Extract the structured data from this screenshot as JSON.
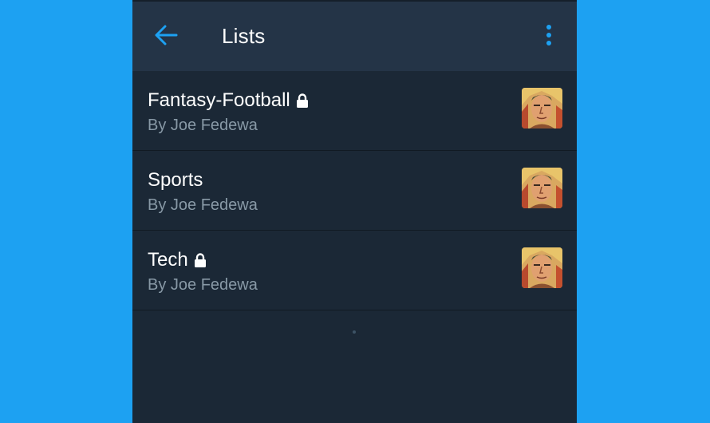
{
  "colors": {
    "background": "#1da1f2",
    "surface": "#1b2836",
    "appbar": "#243447",
    "accent": "#1da1f2",
    "text_primary": "#ffffff",
    "text_secondary": "#8899a6"
  },
  "appbar": {
    "back_icon": "arrow-left-icon",
    "title": "Lists",
    "menu_icon": "more-vertical-icon"
  },
  "lists": [
    {
      "name": "Fantasy-Football",
      "owner": "By Joe Fedewa",
      "private": true
    },
    {
      "name": "Sports",
      "owner": "By Joe Fedewa",
      "private": false
    },
    {
      "name": "Tech",
      "owner": "By Joe Fedewa",
      "private": true
    }
  ]
}
